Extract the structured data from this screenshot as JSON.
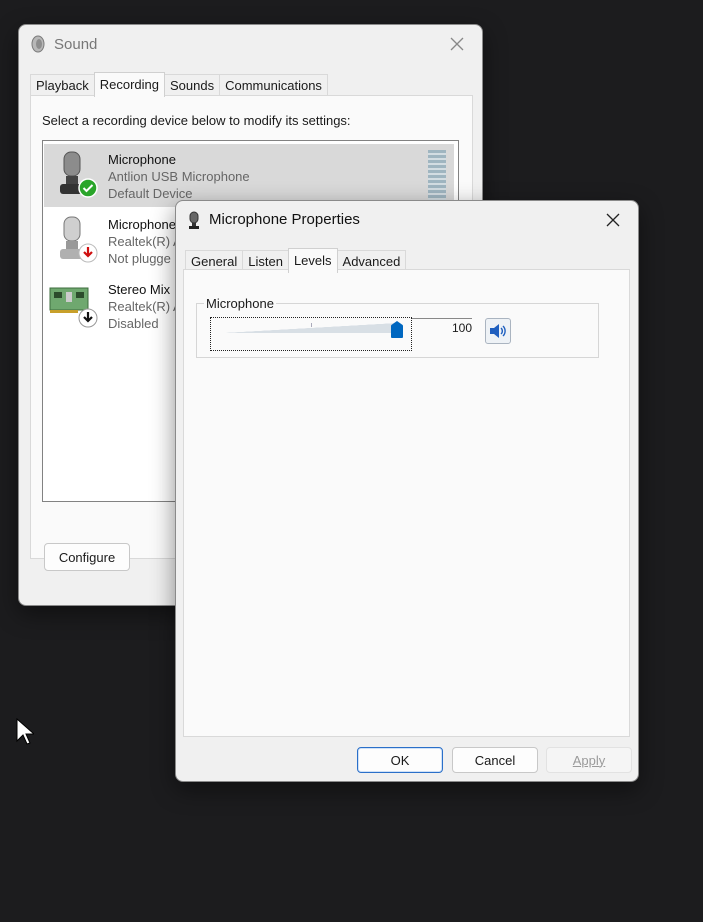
{
  "sound_window": {
    "title": "Sound",
    "tabs": [
      "Playback",
      "Recording",
      "Sounds",
      "Communications"
    ],
    "active_tab": "Recording",
    "instruction": "Select a recording device below to modify its settings:",
    "devices": [
      {
        "name": "Microphone",
        "line2": "Antlion USB Microphone",
        "line3": "Default Device",
        "status_icon": "green-check-icon",
        "selected": true
      },
      {
        "name": "Microphone",
        "line2": "Realtek(R) A",
        "line3": "Not plugge",
        "status_icon": "red-down-arrow-icon",
        "selected": false
      },
      {
        "name": "Stereo Mix",
        "line2": "Realtek(R) A",
        "line3": "Disabled",
        "status_icon": "black-down-arrow-icon",
        "selected": false
      }
    ],
    "configure_label": "Configure"
  },
  "props_window": {
    "title": "Microphone Properties",
    "tabs": [
      "General",
      "Listen",
      "Levels",
      "Advanced"
    ],
    "active_tab": "Levels",
    "group_label": "Microphone",
    "level_value": "100",
    "level_fraction": 1.0,
    "buttons": {
      "ok": "OK",
      "cancel": "Cancel",
      "apply": "Apply"
    }
  },
  "colors": {
    "accent": "#0067c0",
    "meter": "#9fb5c0",
    "desktop": "#1c1c1e"
  }
}
